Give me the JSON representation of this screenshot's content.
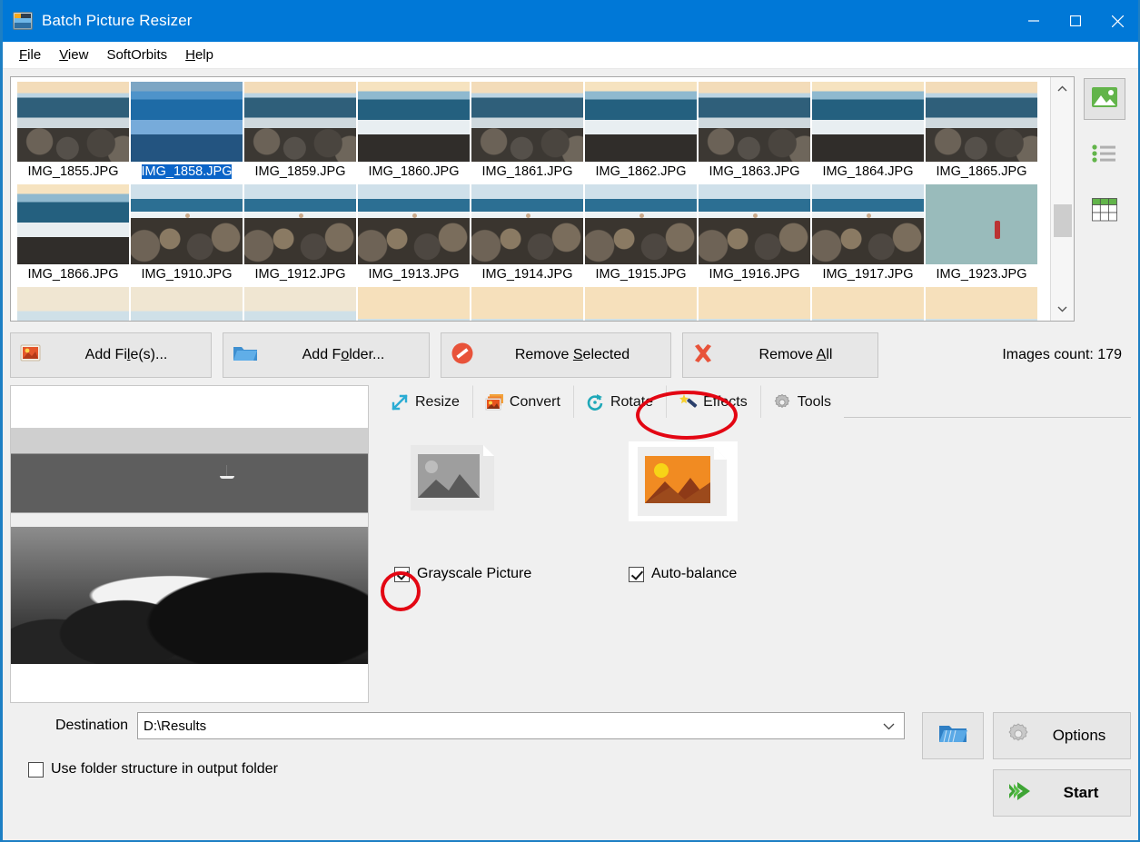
{
  "window": {
    "title": "Batch Picture Resizer",
    "app_icon": "app-picture-icon",
    "controls": {
      "minimize": "minimize-icon",
      "maximize": "maximize-icon",
      "close": "close-icon"
    },
    "title_bar_color": "#0078d7"
  },
  "menu": [
    {
      "label": "File",
      "accel": "F"
    },
    {
      "label": "View",
      "accel": "V"
    },
    {
      "label": "SoftOrbits",
      "accel": ""
    },
    {
      "label": "Help",
      "accel": "H"
    }
  ],
  "thumbnails": {
    "rows": [
      [
        {
          "name": "IMG_1855.JPG",
          "style": "sea1",
          "selected": false
        },
        {
          "name": "IMG_1858.JPG",
          "style": "sea2",
          "selected": true
        },
        {
          "name": "IMG_1859.JPG",
          "style": "sea1",
          "selected": false
        },
        {
          "name": "IMG_1860.JPG",
          "style": "sea2",
          "selected": false
        },
        {
          "name": "IMG_1861.JPG",
          "style": "sea1",
          "selected": false
        },
        {
          "name": "IMG_1862.JPG",
          "style": "sea2",
          "selected": false
        },
        {
          "name": "IMG_1863.JPG",
          "style": "sea1",
          "selected": false
        },
        {
          "name": "IMG_1864.JPG",
          "style": "sea2",
          "selected": false
        },
        {
          "name": "IMG_1865.JPG",
          "style": "sea1",
          "selected": false
        }
      ],
      [
        {
          "name": "IMG_1866.JPG",
          "style": "sea2",
          "selected": false
        },
        {
          "name": "IMG_1910.JPG",
          "style": "rocks",
          "selected": false
        },
        {
          "name": "IMG_1912.JPG",
          "style": "rocks",
          "selected": false
        },
        {
          "name": "IMG_1913.JPG",
          "style": "rocks",
          "selected": false
        },
        {
          "name": "IMG_1914.JPG",
          "style": "rocks",
          "selected": false
        },
        {
          "name": "IMG_1915.JPG",
          "style": "rocks",
          "selected": false
        },
        {
          "name": "IMG_1916.JPG",
          "style": "rocks",
          "selected": false
        },
        {
          "name": "IMG_1917.JPG",
          "style": "rocks",
          "selected": false
        },
        {
          "name": "IMG_1923.JPG",
          "style": "family",
          "selected": false
        }
      ],
      [
        {
          "name": "",
          "style": "beach",
          "selected": false
        },
        {
          "name": "",
          "style": "beach",
          "selected": false
        },
        {
          "name": "",
          "style": "beach",
          "selected": false
        },
        {
          "name": "",
          "style": "sunset",
          "selected": false
        },
        {
          "name": "",
          "style": "sunset",
          "selected": false
        },
        {
          "name": "",
          "style": "sunset",
          "selected": false
        },
        {
          "name": "",
          "style": "sunset",
          "selected": false
        },
        {
          "name": "",
          "style": "sunset",
          "selected": false
        },
        {
          "name": "",
          "style": "sunset",
          "selected": false
        }
      ]
    ],
    "scrollbar": {
      "up": "chevron-up-icon",
      "down": "chevron-down-icon"
    }
  },
  "view_modes": [
    {
      "name": "thumbnail-view",
      "icon": "picture-icon",
      "active": true
    },
    {
      "name": "list-view",
      "icon": "list-icon",
      "active": false
    },
    {
      "name": "details-view",
      "icon": "table-icon",
      "active": false
    }
  ],
  "actions": {
    "add_files": "Add File(s)...",
    "add_folder": "Add Folder...",
    "remove_selected": "Remove Selected",
    "remove_all": "Remove All",
    "images_count": "Images count: 179"
  },
  "tabs": [
    {
      "label": "Resize",
      "icon": "resize-arrow-icon",
      "active": false
    },
    {
      "label": "Convert",
      "icon": "convert-images-icon",
      "active": false
    },
    {
      "label": "Rotate",
      "icon": "rotate-icon",
      "active": false
    },
    {
      "label": "Effects",
      "icon": "magic-wand-icon",
      "active": true
    },
    {
      "label": "Tools",
      "icon": "gear-icon",
      "active": false
    }
  ],
  "effects": {
    "grayscale": {
      "label": "Grayscale Picture",
      "checked": true,
      "icon": "grayscale-photo-icon"
    },
    "autobalance": {
      "label": "Auto-balance",
      "checked": true,
      "icon": "color-photo-icon"
    }
  },
  "destination": {
    "label": "Destination",
    "value": "D:\\Results",
    "dropdown_icon": "chevron-down-icon",
    "browse_icon": "open-folder-icon"
  },
  "folder_structure": {
    "label": "Use folder structure in output folder",
    "checked": false
  },
  "buttons": {
    "options": "Options",
    "start": "Start"
  },
  "annotations": {
    "effects_tab_circle": "red-ellipse-highlight",
    "grayscale_checkbox_circle": "red-circle-highlight",
    "color": "#e30613"
  }
}
